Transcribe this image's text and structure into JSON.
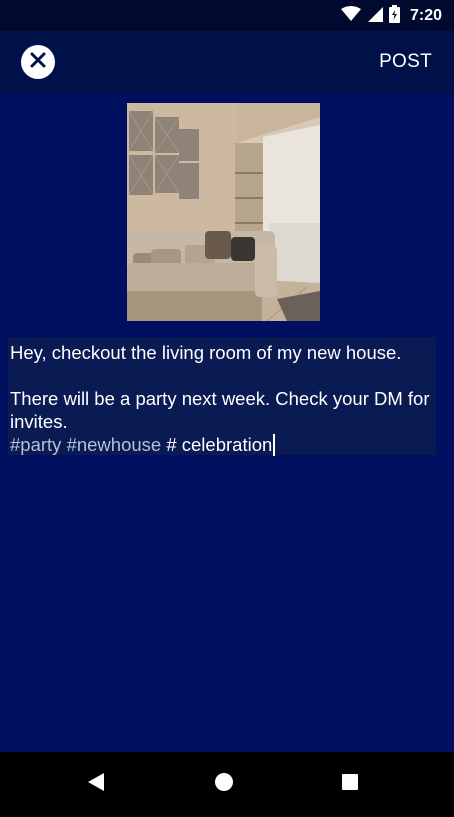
{
  "status_bar": {
    "time": "7:20",
    "icons": [
      "wifi-icon",
      "signal-icon",
      "battery-icon"
    ]
  },
  "app_bar": {
    "close_icon": "close-icon",
    "post_label": "POST"
  },
  "post": {
    "image_icon": "living-room-photo",
    "caption_line1": "Hey, checkout the living room of my new house.",
    "caption_line2": "There will be a party next week. Check your DM for invites.",
    "hashtags": [
      "#party",
      "#newhouse",
      "# celebration"
    ]
  },
  "nav_bar": {
    "icons": [
      "back-icon",
      "home-icon",
      "recents-icon"
    ]
  },
  "colors": {
    "content_bg": "#001060",
    "app_bar_bg": "#001048",
    "caption_bg": "#0a1a52",
    "hashtag_color": "#b7bfd6"
  }
}
